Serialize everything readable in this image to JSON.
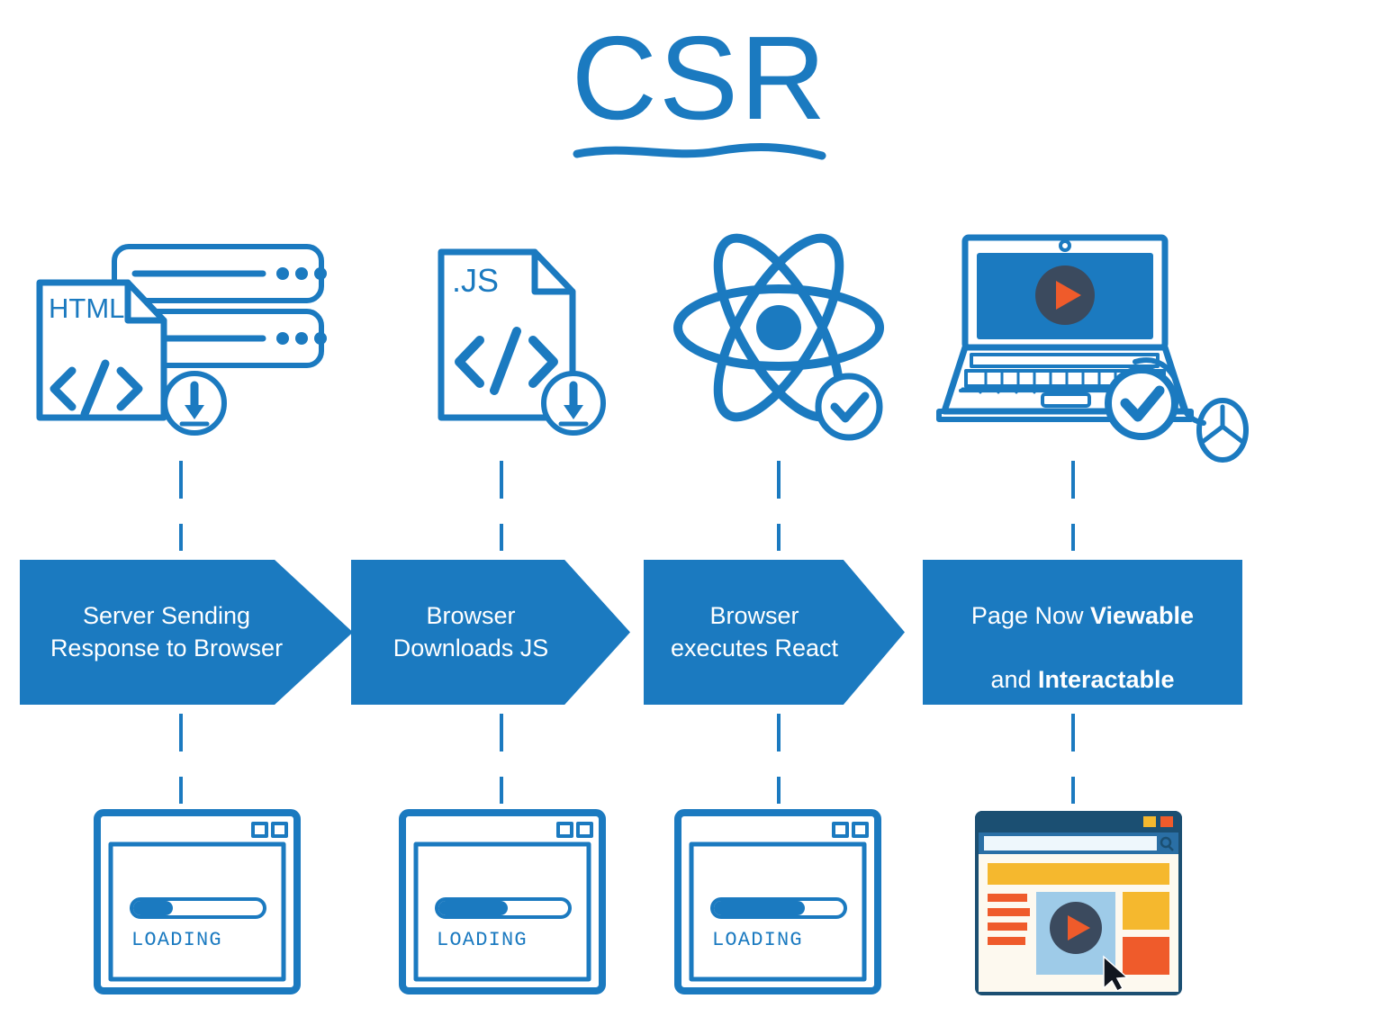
{
  "title": {
    "text": "CSR",
    "accent_color": "#1b7ac0",
    "underline_icon": "wave-underline-icon"
  },
  "colors": {
    "brand_blue": "#1b7ac0",
    "banner_blue": "#1b7ac0",
    "dark_navy": "#1b4f72",
    "screen_blue": "#1b7ac0",
    "dark_circle": "#3b4a5e",
    "orange": "#ef5b2b",
    "yellow": "#f5b82e",
    "light_blue": "#9ecbe8",
    "cream": "#fdf9ef",
    "white": "#ffffff"
  },
  "steps": [
    {
      "id": "step-1",
      "icon": {
        "name": "server-html-download-icon",
        "parts": [
          "server-rack-icon",
          "html-document-icon",
          "code-brackets-icon",
          "download-badge-icon"
        ],
        "document_label": "HTML",
        "code_glyph": "</>"
      },
      "banner": {
        "label": "Server Sending\nResponse to Browser",
        "shape": "chevron",
        "bold_words": []
      },
      "screen": {
        "name": "loading-browser-window",
        "status_text": "LOADING",
        "progress_percent": 30,
        "window_buttons": 2
      }
    },
    {
      "id": "step-2",
      "icon": {
        "name": "js-file-download-icon",
        "parts": [
          "js-document-icon",
          "code-brackets-icon",
          "download-badge-icon"
        ],
        "document_label": ".JS",
        "code_glyph": "</>"
      },
      "banner": {
        "label": "Browser\nDownloads JS",
        "shape": "chevron",
        "bold_words": []
      },
      "screen": {
        "name": "loading-browser-window",
        "status_text": "LOADING",
        "progress_percent": 52,
        "window_buttons": 2
      }
    },
    {
      "id": "step-3",
      "icon": {
        "name": "react-atom-check-icon",
        "parts": [
          "react-atom-icon",
          "check-badge-icon"
        ],
        "document_label": "",
        "code_glyph": ""
      },
      "banner": {
        "label": "Browser\nexecutes React",
        "shape": "chevron",
        "bold_words": []
      },
      "screen": {
        "name": "loading-browser-window",
        "status_text": "LOADING",
        "progress_percent": 68,
        "window_buttons": 2
      }
    },
    {
      "id": "step-4",
      "icon": {
        "name": "laptop-mouse-check-icon",
        "parts": [
          "laptop-icon",
          "play-button-icon",
          "keyboard-icon",
          "mouse-icon",
          "check-badge-icon"
        ],
        "document_label": "",
        "code_glyph": ""
      },
      "banner": {
        "label": "Page Now Viewable\nand Interactable",
        "shape": "rectangle",
        "bold_words": [
          "Viewable",
          "Interactable"
        ],
        "line1_plain": "Page Now ",
        "line1_bold": "Viewable",
        "line2_plain": "and ",
        "line2_bold": "Interactable"
      },
      "screen": {
        "name": "rendered-page-window",
        "status_text": "",
        "progress_percent": 100,
        "window_buttons": 2,
        "elements": [
          "search-bar",
          "hero-banner",
          "nav-list",
          "video-block",
          "play-button",
          "side-card-yellow",
          "side-card-orange",
          "cursor-pointer"
        ]
      }
    }
  ]
}
